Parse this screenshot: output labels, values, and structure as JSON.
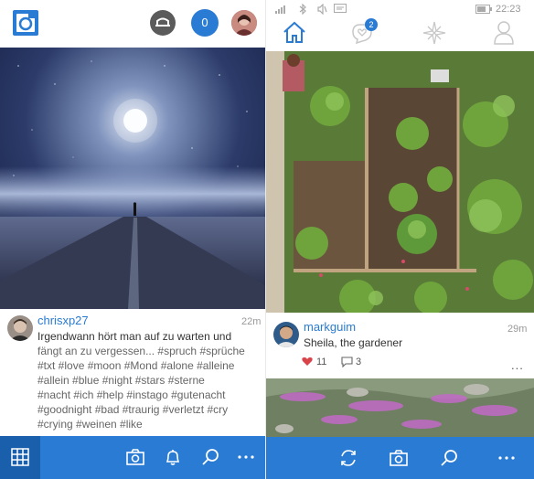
{
  "left": {
    "notification_count": "0",
    "post": {
      "username": "chrisxp27",
      "time": "22m",
      "caption_lines": [
        "Irgendwann hört man auf zu warten und",
        "fängt an zu vergessen... #spruch #sprüche",
        "#txt #love #moon #Mond #alone #alleine",
        "#allein #blue #night #stars #sterne",
        "#nacht #ich #help #instago #gutenacht",
        "#goodnight #bad #traurig #verletzt #cry",
        "#crying #weinen #like"
      ]
    },
    "bottom_bar": [
      "grid-icon",
      "camera-icon",
      "bell-icon",
      "search-icon",
      "more-icon"
    ]
  },
  "right": {
    "status_time": "22:23",
    "activity_badge": "2",
    "post": {
      "username": "markguim",
      "time": "29m",
      "caption": "Sheila, the gardener",
      "likes": "11",
      "comments": "3",
      "more": "..."
    },
    "bottom_bar": [
      "refresh-icon",
      "camera-icon",
      "search-icon",
      "more-icon"
    ]
  },
  "colors": {
    "accent": "#2a7bd3",
    "like": "#d9434a"
  }
}
